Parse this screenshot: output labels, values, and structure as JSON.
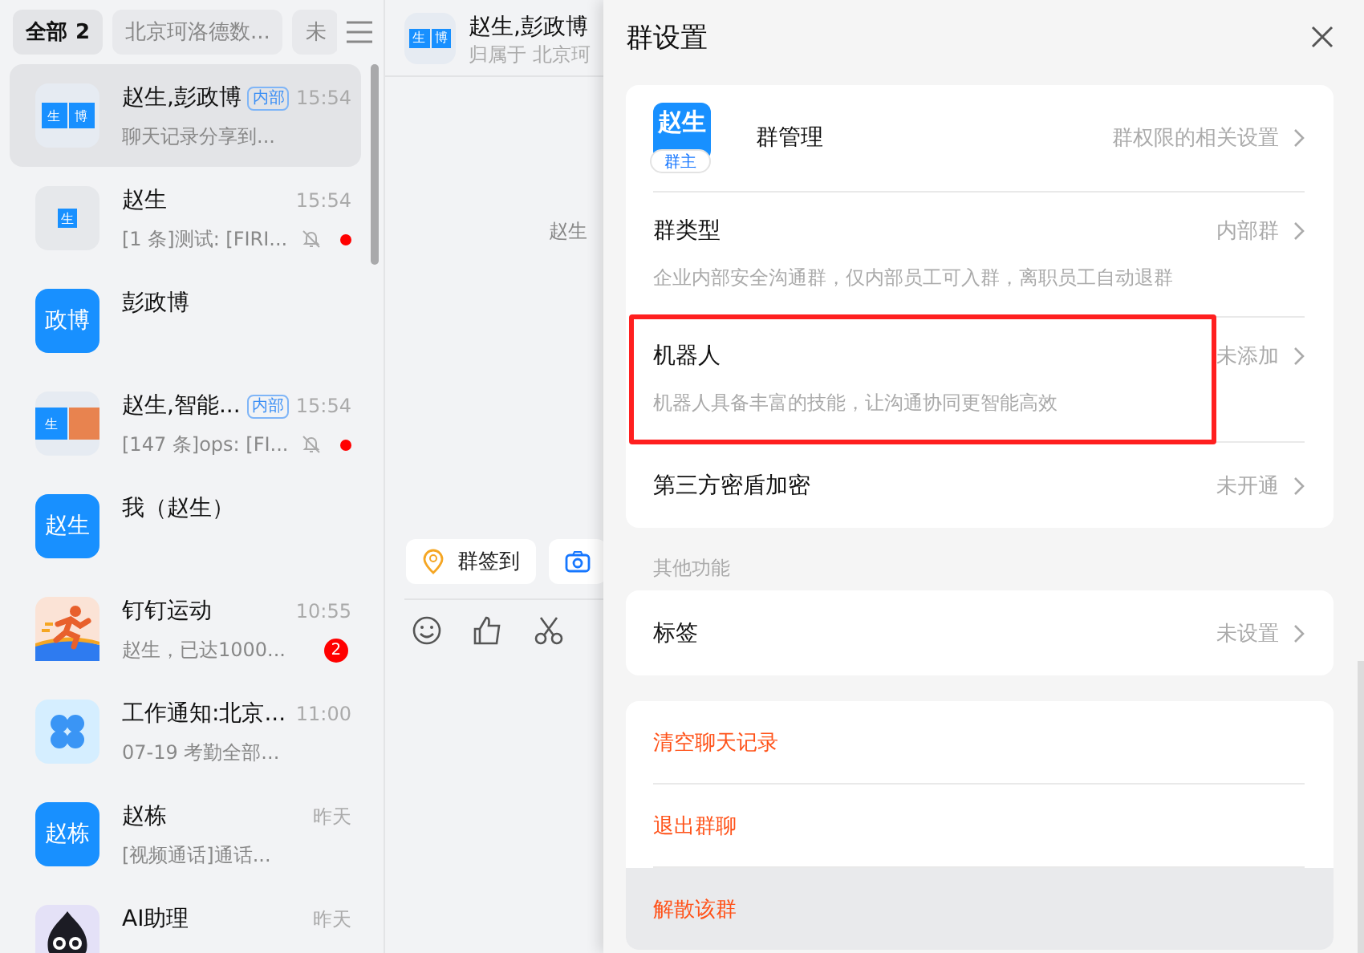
{
  "sidebar": {
    "filters": [
      {
        "label": "全部",
        "count": "2",
        "selected": true
      },
      {
        "label": "北京珂洛德数...",
        "selected": false
      },
      {
        "label": "未",
        "selected": false
      }
    ],
    "conversations": [
      {
        "name": "赵生,彭政博",
        "tag": "内部",
        "time": "15:54",
        "preview": "聊天记录分享到...",
        "selected": true,
        "muted": false,
        "unread": false,
        "avatar": {
          "kind": "split",
          "texts": [
            "生",
            "博"
          ]
        }
      },
      {
        "name": "赵生",
        "time": "15:54",
        "preview": "[1 条]测试: [FIRI...",
        "selected": false,
        "muted": true,
        "unread": true,
        "avatar": {
          "kind": "small",
          "texts": [
            "生"
          ]
        }
      },
      {
        "name": "彭政博",
        "selected": false,
        "muted": false,
        "unread": false,
        "avatar": {
          "kind": "text",
          "texts": [
            "政博"
          ]
        }
      },
      {
        "name": "赵生,智能...",
        "tag": "内部",
        "time": "15:54",
        "preview": "[147 条]ops: [FI...",
        "selected": false,
        "muted": true,
        "unread": true,
        "avatar": {
          "kind": "photo-split",
          "texts": [
            "生"
          ]
        }
      },
      {
        "name": "我（赵生）",
        "selected": false,
        "muted": false,
        "unread": false,
        "avatar": {
          "kind": "text",
          "texts": [
            "赵生"
          ]
        }
      },
      {
        "name": "钉钉运动",
        "time": "10:55",
        "preview": "赵生，已达1000...",
        "badge": "2",
        "selected": false,
        "muted": false,
        "unread": false,
        "avatar": {
          "kind": "sport"
        }
      },
      {
        "name": "工作通知:北京...",
        "time": "11:00",
        "preview": "07-19 考勤全部...",
        "selected": false,
        "muted": false,
        "unread": false,
        "avatar": {
          "kind": "work"
        }
      },
      {
        "name": "赵栋",
        "time": "昨天",
        "preview": "[视频通话]通话...",
        "selected": false,
        "muted": false,
        "unread": false,
        "avatar": {
          "kind": "text",
          "texts": [
            "赵栋"
          ]
        }
      },
      {
        "name": "AI助理",
        "time": "昨天",
        "selected": false,
        "muted": false,
        "unread": false,
        "avatar": {
          "kind": "mascot"
        }
      }
    ]
  },
  "chat": {
    "title": "赵生,彭政博",
    "subtitle": "归属于 北京珂",
    "avatar": {
      "kind": "split",
      "texts": [
        "生",
        "博"
      ]
    },
    "notice": "赵生",
    "quick_actions": [
      {
        "kind": "checkin",
        "label": "群签到"
      },
      {
        "kind": "camera"
      }
    ]
  },
  "drawer": {
    "title": "群设置",
    "cards": [
      {
        "rows": [
          {
            "kind": "owner",
            "avatar_text": "赵生",
            "owner_badge": "群主",
            "label": "群管理",
            "value": "群权限的相关设置",
            "highlighted": false
          },
          {
            "kind": "setting",
            "label": "群类型",
            "value": "内部群",
            "description": "企业内部安全沟通群，仅内部员工可入群，离职员工自动退群",
            "highlighted": false
          },
          {
            "kind": "setting",
            "label": "机器人",
            "value": "未添加",
            "description": "机器人具备丰富的技能，让沟通协同更智能高效",
            "highlighted": true
          },
          {
            "kind": "setting",
            "label": "第三方密盾加密",
            "value": "未开通",
            "highlighted": false
          }
        ]
      },
      {
        "section": "其他功能",
        "rows": [
          {
            "kind": "setting",
            "label": "标签",
            "value": "未设置",
            "highlighted": false
          }
        ]
      },
      {
        "rows": [
          {
            "kind": "danger",
            "label": "清空聊天记录",
            "hovered": false
          },
          {
            "kind": "danger",
            "label": "退出群聊",
            "hovered": false
          },
          {
            "kind": "danger",
            "label": "解散该群",
            "hovered": true
          }
        ]
      }
    ]
  }
}
